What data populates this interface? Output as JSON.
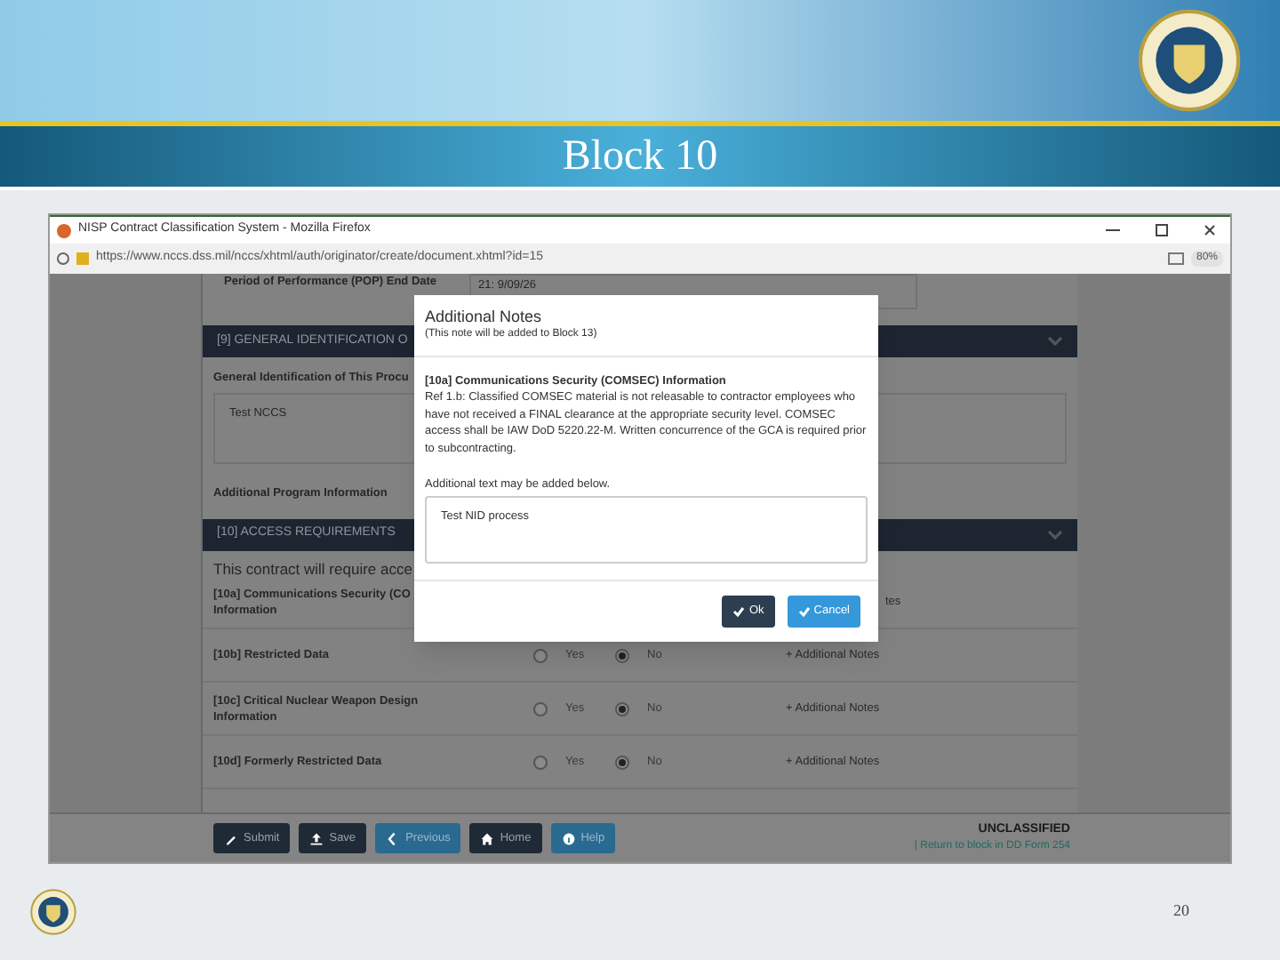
{
  "slide": {
    "title": "Block 10",
    "page_number": "20"
  },
  "browser": {
    "title": "NISP Contract Classification System - Mozilla Firefox",
    "url": "https://www.nccs.dss.mil/nccs/xhtml/auth/originator/create/document.xhtml?id=15",
    "zoom": "80%"
  },
  "form": {
    "pop": {
      "label": "Period of Performance (POP) End Date",
      "value": "21: 9/09/26"
    },
    "section_9": {
      "header": "[9] GENERAL IDENTIFICATION O",
      "field_label": "General Identification of This Procu",
      "field_value": "Test NCCS",
      "extra_label": "Additional Program Information"
    },
    "section_10": {
      "header": "[10] ACCESS REQUIREMENTS",
      "intro": "This contract will require acce",
      "items": [
        {
          "label": "[10a] Communications Security (CO",
          "label_2": "Information",
          "note": "tes"
        },
        {
          "label": "[10b] Restricted Data",
          "options": [
            {
              "label": "Yes",
              "selected": false
            },
            {
              "label": "No",
              "selected": true
            }
          ],
          "note": "+ Additional Notes"
        },
        {
          "label": "[10c] Critical Nuclear Weapon Design",
          "label_2": "Information",
          "options": [
            {
              "label": "Yes",
              "selected": false
            },
            {
              "label": "No",
              "selected": true
            }
          ],
          "note": "+ Additional Notes"
        },
        {
          "label": "[10d] Formerly Restricted Data",
          "options": [
            {
              "label": "Yes",
              "selected": false
            },
            {
              "label": "No",
              "selected": true
            }
          ],
          "note": "+ Additional Notes"
        }
      ]
    },
    "buttons": [
      {
        "kind": "dark",
        "label": "Submit"
      },
      {
        "kind": "dark",
        "label": "Save"
      },
      {
        "kind": "blue",
        "label": "Previous"
      },
      {
        "kind": "dark",
        "label": "Home"
      },
      {
        "kind": "blue",
        "label": "Help"
      }
    ],
    "classification": "UNCLASSIFIED",
    "return_link": "| Return to block in DD Form 254"
  },
  "modal": {
    "title": "Additional Notes",
    "subtitle": "(This note will be added to Block 13)",
    "heading": "[10a] Communications Security (COMSEC) Information",
    "body": "Ref 1.b: Classified COMSEC material is not releasable to contractor employees who have not received a FINAL clearance at the appropriate security level. COMSEC access shall be IAW DoD 5220.22-M. Written concurrence of the GCA is required prior to subcontracting.",
    "prompt": "Additional text may be added below.",
    "text": "Test NID process",
    "buttons": [
      {
        "kind": "dark",
        "label": "Ok"
      },
      {
        "kind": "blue",
        "label": "Cancel"
      }
    ]
  }
}
